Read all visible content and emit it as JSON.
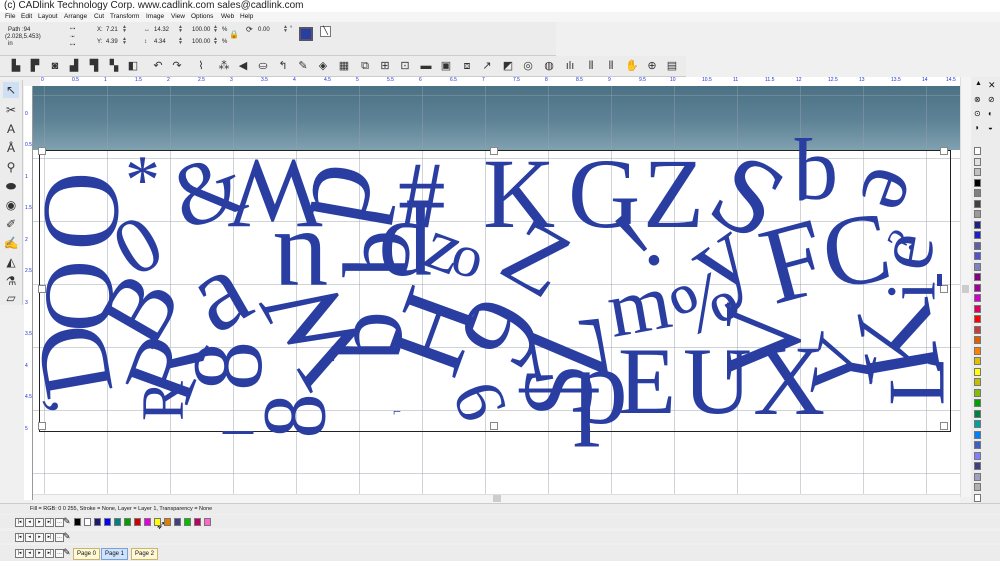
{
  "window": {
    "title": "(c) CADlink Technology Corp.  www.cadlink.com  sales@cadlink.com"
  },
  "menu": [
    "File",
    "Edit",
    "Layout",
    "Arrange",
    "Cut",
    "Transform",
    "Image",
    "View",
    "Options",
    "Web",
    "Help"
  ],
  "properties": {
    "object_info": "Path :94",
    "object_coords": "(2.028,5.453)",
    "units": "in",
    "x_label": "X:",
    "x": "7.21",
    "y_label": "Y:",
    "y": "4.39",
    "w": "14.32",
    "h": "4.34",
    "scale_w": "100.00",
    "scale_h": "100.00",
    "percent": "%",
    "rotation": "0.00",
    "degree": "°"
  },
  "ruler_top": [
    "0",
    "0.5",
    "1",
    "1.5",
    "2",
    "2.5",
    "3",
    "3.5",
    "4",
    "4.5",
    "5",
    "5.5",
    "6",
    "6.5",
    "7",
    "7.5",
    "8",
    "8.5",
    "9",
    "9.5",
    "10",
    "10.5",
    "11",
    "11.5",
    "12",
    "12.5",
    "13",
    "13.5",
    "14",
    "14.5"
  ],
  "ruler_left": [
    "0",
    "0.5",
    "1",
    "1.5",
    "2",
    "2.5",
    "3",
    "3.5",
    "4",
    "4.5",
    "5"
  ],
  "status": {
    "text": "Fill = RGB: 0 0 255, Stroke = None, Layer = Layer 1, Transparency = None"
  },
  "pages": [
    "Page 0",
    "Page 1",
    "Page 2"
  ],
  "active_page": "Page 1",
  "colors": {
    "glyph": "#2a3ea2",
    "palette": [
      "#000000",
      "#ffffff",
      "#1a1a6e",
      "#0000ff",
      "#008080",
      "#00a000",
      "#d00000",
      "#e000e0",
      "#ffff00",
      "#e08000",
      "#404080",
      "#00c000",
      "#c00060",
      "#ff66cc"
    ],
    "right_palette": [
      "#ffffff",
      "#e0e0e0",
      "#c0c0c0",
      "#000000",
      "#808080",
      "#404040",
      "#9a9a9a",
      "#202080",
      "#2020c0",
      "#6060a0",
      "#5050d0",
      "#8080c0",
      "#800080",
      "#a000a0",
      "#d000d0",
      "#e00060",
      "#ff0000",
      "#c04040",
      "#e06000",
      "#ff8000",
      "#e0c000",
      "#ffff00",
      "#c0c000",
      "#80c000",
      "#00a000",
      "#008040",
      "#00a0a0",
      "#0080ff",
      "#4060c0",
      "#8080ff",
      "#404080",
      "#a0a0c0",
      "#b0b0b0",
      "#ffffff",
      "#d0d0d0"
    ]
  },
  "glyphs": [
    "O",
    "*",
    "&",
    "W",
    "d",
    "#",
    "K",
    "G",
    "Z",
    "S",
    "q",
    "e",
    "z",
    "0",
    "O",
    "B",
    "a",
    "u",
    "b",
    "p",
    "o",
    "Z",
    "!",
    "y",
    "F",
    "C",
    "e",
    "D",
    "R",
    "8",
    "W",
    "b",
    "H",
    "9",
    "Z",
    "m",
    "%",
    "K",
    "i",
    "ʻ",
    "R",
    "8",
    "p",
    "V",
    "$",
    "E",
    "U",
    "X",
    "Y",
    "L",
    "_",
    "9",
    "⌐",
    "?"
  ]
}
